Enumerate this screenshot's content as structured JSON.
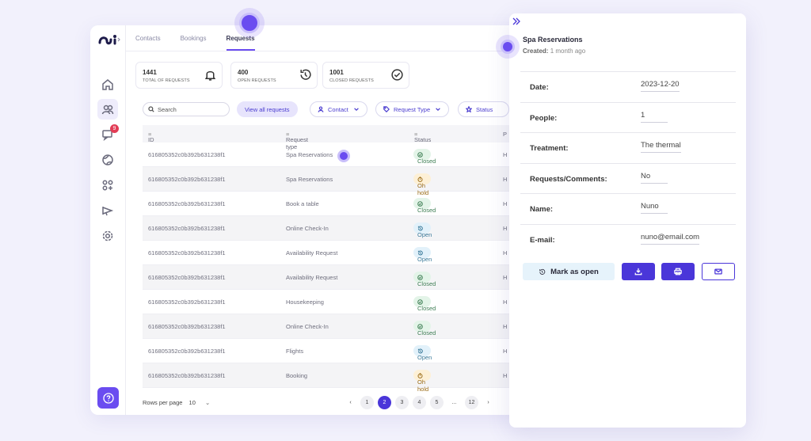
{
  "tabs": [
    "Contacts",
    "Bookings",
    "Requests"
  ],
  "active_tab": "Requests",
  "nav_icons": [
    "home-icon",
    "users-icon",
    "chat-icon",
    "globe-icon",
    "apps-icon",
    "megaphone-icon",
    "settings-icon"
  ],
  "notification_count": "9",
  "stats": [
    {
      "number": "1441",
      "label": "Total of requests",
      "icon": "bell-icon"
    },
    {
      "number": "400",
      "label": "Open requests",
      "icon": "history-icon"
    },
    {
      "number": "1001",
      "label": "Closed requests",
      "icon": "check-circle-icon"
    }
  ],
  "search": {
    "placeholder": "Search"
  },
  "filters": {
    "view_all": "View all requests",
    "contact": "Contact",
    "request_type": "Request Type",
    "status": "Status"
  },
  "table": {
    "columns": [
      "ID",
      "Request type",
      "Status",
      "P"
    ],
    "rows": [
      {
        "id": "616805352c0b392b631238f1",
        "type": "Spa Reservations",
        "status": "Closed",
        "tail": "H"
      },
      {
        "id": "616805352c0b392b631238f1",
        "type": "Spa Reservations",
        "status": "Oh hold",
        "tail": "H"
      },
      {
        "id": "616805352c0b392b631238f1",
        "type": "Book a table",
        "status": "Closed",
        "tail": "H"
      },
      {
        "id": "616805352c0b392b631238f1",
        "type": "Online Check-In",
        "status": "Open",
        "tail": "H"
      },
      {
        "id": "616805352c0b392b631238f1",
        "type": "Availability Request",
        "status": "Open",
        "tail": "H"
      },
      {
        "id": "616805352c0b392b631238f1",
        "type": "Availability Request",
        "status": "Closed",
        "tail": "H"
      },
      {
        "id": "616805352c0b392b631238f1",
        "type": "Housekeeping",
        "status": "Closed",
        "tail": "H"
      },
      {
        "id": "616805352c0b392b631238f1",
        "type": "Online Check-In",
        "status": "Closed",
        "tail": "H"
      },
      {
        "id": "616805352c0b392b631238f1",
        "type": "Flights",
        "status": "Open",
        "tail": "H"
      },
      {
        "id": "616805352c0b392b631238f1",
        "type": "Booking",
        "status": "Oh hold",
        "tail": "H"
      }
    ]
  },
  "pagination": {
    "rows_per_page_label": "Rows per page",
    "rows_per_page": "10",
    "pages": [
      "1",
      "2",
      "3",
      "4",
      "5",
      "...",
      "12"
    ],
    "current": "2"
  },
  "panel": {
    "title": "Spa Reservations",
    "created_label": "Created:",
    "created_value": "1 month ago",
    "fields": [
      {
        "key": "Date:",
        "value": "2023-12-20"
      },
      {
        "key": "People:",
        "value": "1"
      },
      {
        "key": "Treatment:",
        "value": "The thermal"
      },
      {
        "key": "Requests/Comments:",
        "value": "No"
      },
      {
        "key": "Name:",
        "value": "Nuno"
      },
      {
        "key": "E-mail:",
        "value": "nuno@email.com"
      }
    ],
    "mark_open": "Mark as open"
  },
  "colors": {
    "accent": "#4a36d9",
    "accent_light": "#6a4cf0",
    "background": "#f2f1fc"
  }
}
